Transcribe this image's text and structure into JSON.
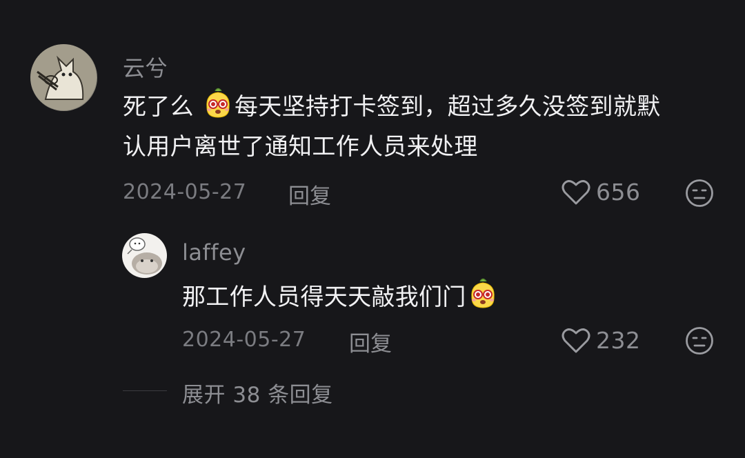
{
  "comments": [
    {
      "username": "云兮",
      "text_before_emoji": "死了么 ",
      "text_after_emoji": "每天坚持打卡签到，超过多久没签到就默",
      "text_line2": "认用户离世了通知工作人员来处理",
      "emoji_icon": "yellow-face-emoji",
      "date": "2024-05-27",
      "reply_label": "回复",
      "like_count": "656",
      "avatar_icon": "cat-avatar"
    }
  ],
  "replies": [
    {
      "username": "laffey",
      "text": "那工作人员得天天敲我们门",
      "emoji_icon": "yellow-face-emoji",
      "date": "2024-05-27",
      "reply_label": "回复",
      "like_count": "232",
      "avatar_icon": "cat-avatar"
    }
  ],
  "expand_replies_label": "展开 38 条回复",
  "colors": {
    "background": "#17171a",
    "primary_text": "#f1f1f3",
    "secondary_text": "#8d8e93",
    "meta_text": "#7b7c81"
  }
}
